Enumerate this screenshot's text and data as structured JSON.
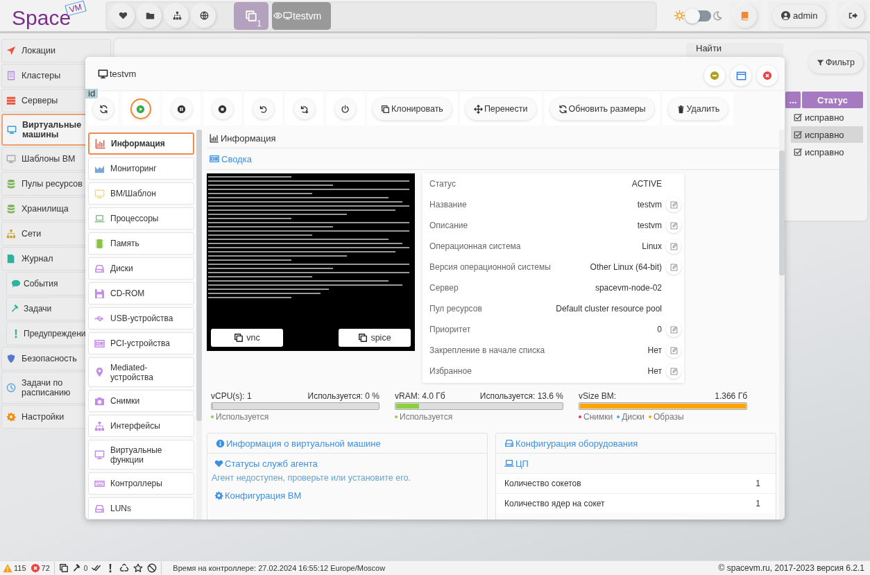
{
  "header": {
    "logo": {
      "text": "Space",
      "badge": "VM"
    },
    "tasks_count": "1",
    "open_tabs": [
      {
        "label": "testvm"
      }
    ],
    "dark_theme": false,
    "user": "admin"
  },
  "sidebar": {
    "items": [
      {
        "label": "Локации",
        "selected": false
      },
      {
        "label": "Кластеры",
        "selected": false
      },
      {
        "label": "Серверы",
        "selected": false
      },
      {
        "label": "Виртуальные машины",
        "selected": true
      },
      {
        "label": "Шаблоны ВМ",
        "selected": false
      },
      {
        "label": "Пулы ресурсов",
        "selected": false
      },
      {
        "label": "Хранилища",
        "selected": false
      },
      {
        "label": "Сети",
        "selected": false
      },
      {
        "label": "Журнал",
        "selected": false,
        "children": [
          {
            "label": "События"
          },
          {
            "label": "Задачи"
          },
          {
            "label": "Предупреждени"
          }
        ]
      },
      {
        "label": "Безопасность",
        "selected": false
      },
      {
        "label": "Задачи по расписанию",
        "selected": false
      },
      {
        "label": "Настройки",
        "selected": false
      }
    ]
  },
  "vm_list": {
    "search_label": "Найти",
    "filter_button": "Фильтр",
    "columns": [
      "...",
      "Статус"
    ],
    "rows": [
      {
        "status": "исправно",
        "selected": false
      },
      {
        "status": "исправно",
        "selected": true
      },
      {
        "status": "исправно",
        "selected": false
      }
    ]
  },
  "modal": {
    "title": "testvm",
    "id_badge": "id",
    "icon_buttons": [
      {
        "selected": false
      },
      {
        "selected": true
      },
      {
        "selected": false
      },
      {
        "selected": false
      },
      {
        "selected": false
      },
      {
        "selected": false
      },
      {
        "selected": false
      }
    ],
    "text_buttons": [
      "Клонировать",
      "Перенести",
      "Обновить размеры",
      "Удалить"
    ],
    "tabs": [
      {
        "label": "Информация",
        "selected": true
      },
      {
        "label": "Мониторинг",
        "selected": false
      },
      {
        "label": "ВМ/Шаблон",
        "selected": false
      },
      {
        "label": "Процессоры",
        "selected": false
      },
      {
        "label": "Память",
        "selected": false
      },
      {
        "label": "Диски",
        "selected": false
      },
      {
        "label": "CD-ROM",
        "selected": false
      },
      {
        "label": "USB-устройства",
        "selected": false
      },
      {
        "label": "PCI-устройства",
        "selected": false
      },
      {
        "label": "Mediated-устройства",
        "selected": false
      },
      {
        "label": "Снимки",
        "selected": false
      },
      {
        "label": "Интерфейсы",
        "selected": false
      },
      {
        "label": "Виртуальные функции",
        "selected": false
      },
      {
        "label": "Контроллеры",
        "selected": false
      },
      {
        "label": "LUNs",
        "selected": false
      }
    ],
    "section_title": "Информация",
    "summary_title": "Сводка",
    "console_buttons": [
      "vnc",
      "spice"
    ],
    "properties": [
      {
        "label": "Статус",
        "value": "ACTIVE",
        "editable": false
      },
      {
        "label": "Название",
        "value": "testvm",
        "editable": true
      },
      {
        "label": "Описание",
        "value": "testvm",
        "editable": true
      },
      {
        "label": "Операционная система",
        "value": "Linux",
        "editable": true
      },
      {
        "label": "Версия операционной системы",
        "value": "Other Linux (64-bit)",
        "editable": true
      },
      {
        "label": "Сервер",
        "value": "spacevm-node-02",
        "editable": false
      },
      {
        "label": "Пул ресурсов",
        "value": "Default cluster resource pool",
        "editable": false
      },
      {
        "label": "Приоритет",
        "value": "0",
        "editable": true
      },
      {
        "label": "Закрепление в начале списка",
        "value": "Нет",
        "editable": true
      },
      {
        "label": "Избранное",
        "value": "Нет",
        "editable": true
      }
    ],
    "meters": [
      {
        "label": "vCPU(s): 1",
        "reading": "Используется: 0 %",
        "level": 0,
        "legend": [
          {
            "label": "Используется",
            "color": "#8bd13a"
          }
        ]
      },
      {
        "label": "vRAM: 4.0 Гб",
        "reading": "Используется: 13.6 %",
        "level": 0.136,
        "color": "#8bd13a",
        "legend": [
          {
            "label": "Используется",
            "color": "#8bd13a"
          }
        ]
      },
      {
        "label": "vSize ВМ:",
        "reading": "1.366 Гб",
        "level": 1,
        "color": "#ffa500",
        "legend": [
          {
            "label": "Снимки",
            "color": "#e0307a"
          },
          {
            "label": "Диски",
            "color": "#3ab0e8"
          },
          {
            "label": "Образы",
            "color": "#ffa500"
          }
        ]
      }
    ],
    "vm_info_panel": {
      "title": "Информация о виртуальной машине",
      "sections": [
        {
          "title": "Статусы служб агента",
          "note": "Агент недоступен, проверьте или установите его."
        },
        {
          "title": "Конфигурация ВМ"
        }
      ]
    },
    "hardware_panel": {
      "title": "Конфигурация оборудования",
      "subtitle": "ЦП",
      "rows": [
        {
          "label": "Количество сокетов",
          "value": "1"
        },
        {
          "label": "Количество ядер на сокет",
          "value": "1"
        }
      ]
    }
  },
  "status_bar": {
    "warnings": "115",
    "errors": "72",
    "tasks": "0",
    "time": "Время на контроллере: 27.02.2024 16:55:12 Europe/Moscow",
    "copyright": "© spacevm.ru, 2017-2023 версия 6.2.1"
  }
}
